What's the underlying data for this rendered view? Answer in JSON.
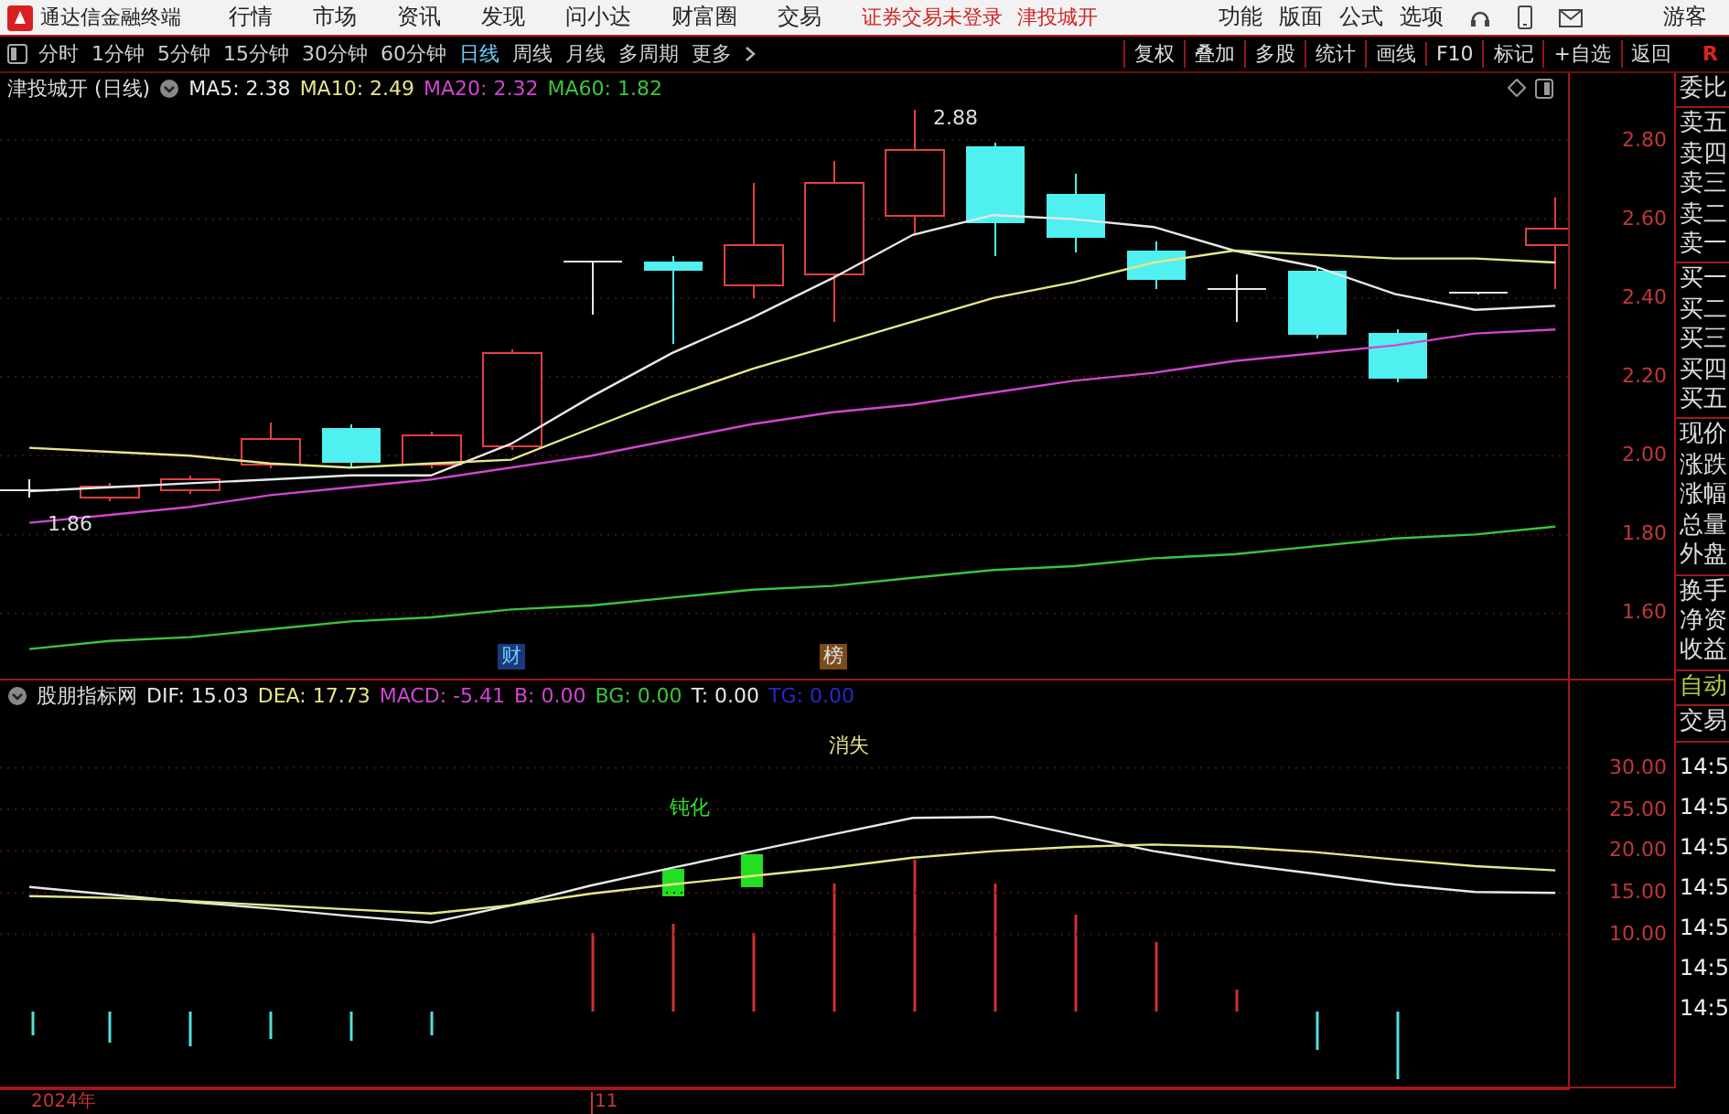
{
  "app_bar": {
    "title": "通达信金融终端",
    "menus": [
      "行情",
      "市场",
      "资讯",
      "发现",
      "问小达",
      "财富圈",
      "交易"
    ],
    "status_messages": [
      "证券交易未登录",
      "津投城开"
    ],
    "tools": [
      "功能",
      "版面",
      "公式",
      "选项"
    ],
    "user": "游客"
  },
  "toolbar": {
    "periods": [
      {
        "label": "分时",
        "selected": false
      },
      {
        "label": "1分钟",
        "selected": false
      },
      {
        "label": "5分钟",
        "selected": false
      },
      {
        "label": "15分钟",
        "selected": false
      },
      {
        "label": "30分钟",
        "selected": false
      },
      {
        "label": "60分钟",
        "selected": false
      },
      {
        "label": "日线",
        "selected": true
      },
      {
        "label": "周线",
        "selected": false
      },
      {
        "label": "月线",
        "selected": false
      },
      {
        "label": "多周期",
        "selected": false
      },
      {
        "label": "更多",
        "selected": false
      }
    ],
    "actions": [
      "复权",
      "叠加",
      "多股",
      "统计",
      "画线",
      "F10",
      "标记",
      "+自选",
      "返回"
    ],
    "badge": "R"
  },
  "chart": {
    "title": "津投城开 (日线)",
    "legend_values": [
      ": 2.38",
      ": 2.49",
      ": 2.32",
      ": 1.82"
    ],
    "high_label": "2.88",
    "low_label": "1.86",
    "markers": [
      {
        "text": "财",
        "color": "#1a3a7a"
      },
      {
        "text": "榜",
        "color": "#7a4a1a"
      }
    ],
    "chart_data": {
      "type": "line",
      "grid": true,
      "ylim": [
        1.43,
        2.97
      ],
      "yticks": [
        {
          "value": 2.8,
          "label": "2.80"
        },
        {
          "value": 2.6,
          "label": "2.60"
        },
        {
          "value": 2.4,
          "label": "2.40"
        },
        {
          "value": 2.2,
          "label": "2.20"
        },
        {
          "value": 2.0,
          "label": "2.00"
        },
        {
          "value": 1.8,
          "label": "1.80"
        },
        {
          "value": 1.6,
          "label": "1.60"
        }
      ],
      "series": [
        {
          "name": "MA5",
          "color": "#e8e8e8",
          "values": [
            1.91,
            1.92,
            1.93,
            1.94,
            1.95,
            1.95,
            2.03,
            2.15,
            2.26,
            2.35,
            2.45,
            2.56,
            2.61,
            2.6,
            2.58,
            2.52,
            2.48,
            2.41,
            2.37,
            2.38
          ]
        },
        {
          "name": "MA10",
          "color": "#e6e68a",
          "values": [
            2.02,
            2.01,
            2.0,
            1.98,
            1.97,
            1.98,
            1.99,
            2.07,
            2.15,
            2.22,
            2.28,
            2.34,
            2.4,
            2.44,
            2.49,
            2.52,
            2.51,
            2.5,
            2.5,
            2.49
          ]
        },
        {
          "name": "MA20",
          "color": "#d046d0",
          "values": [
            1.83,
            1.85,
            1.87,
            1.9,
            1.92,
            1.94,
            1.97,
            2.0,
            2.04,
            2.08,
            2.11,
            2.13,
            2.16,
            2.19,
            2.21,
            2.24,
            2.26,
            2.28,
            2.31,
            2.32
          ]
        },
        {
          "name": "MA60",
          "color": "#3cc43c",
          "values": [
            1.51,
            1.53,
            1.54,
            1.56,
            1.58,
            1.59,
            1.61,
            1.62,
            1.64,
            1.66,
            1.67,
            1.69,
            1.71,
            1.72,
            1.74,
            1.75,
            1.77,
            1.79,
            1.8,
            1.82
          ]
        }
      ]
    }
  },
  "indicator_panel": {
    "name": "股朋指标网",
    "legend_values": [
      ": 15.03",
      ": 17.73"
    ],
    "chart_data": {
      "type": "line",
      "grid": true,
      "ylim": [
        -8.5,
        40.5
      ],
      "yticks": [
        {
          "value": 30,
          "label": "30.00"
        },
        {
          "value": 25,
          "label": "25.00"
        },
        {
          "value": 20,
          "label": "20.00"
        },
        {
          "value": 15,
          "label": "15.00"
        },
        {
          "value": 10,
          "label": "10.00"
        }
      ],
      "series": [
        {
          "name": "DIF",
          "color": "#e8e8e8",
          "values": [
            15.7,
            14.8,
            13.9,
            13.1,
            12.2,
            11.4,
            13.5,
            15.9,
            18.0,
            20.0,
            22.0,
            24.0,
            24.1,
            22.0,
            20.0,
            18.5,
            17.3,
            16.0,
            15.1,
            15.0
          ]
        },
        {
          "name": "DEA",
          "color": "#e6e68a",
          "values": [
            14.6,
            14.4,
            14.0,
            13.5,
            13.0,
            12.5,
            13.5,
            14.9,
            16.0,
            17.0,
            18.0,
            19.2,
            20.0,
            20.5,
            20.8,
            20.5,
            19.9,
            19.0,
            18.2,
            17.7
          ]
        }
      ]
    },
    "legend": [
      {
        "label": "MACD: -5.41",
        "color": "#d046d0"
      },
      {
        "label": "B: 0.00",
        "color": "#d046d0"
      },
      {
        "label": "BG: 0.00",
        "color": "#3cc43c"
      },
      {
        "label": "T: 0.00",
        "color": "#e8e8e8"
      },
      {
        "label": "TG: 0.00",
        "color": "#2828c8"
      }
    ],
    "notes": [
      {
        "text": "消失",
        "color": "#e6e68a"
      },
      {
        "text": "钝化",
        "color": "#30e030"
      }
    ]
  },
  "date_axis": [
    "2024年",
    "11"
  ],
  "quote_panel": {
    "groups": [
      [
        "委比"
      ],
      [
        "卖五",
        "卖四",
        "卖三",
        "卖二",
        "卖一"
      ],
      [
        "买一",
        "买二",
        "买三",
        "买四",
        "买五"
      ],
      [
        "现价",
        "涨跌",
        "涨幅",
        "总量",
        "外盘"
      ],
      [
        "换手",
        "净资",
        "收益"
      ]
    ],
    "mode": "自动",
    "section": "交易",
    "times": [
      "14:5",
      "14:5",
      "14:5",
      "14:5",
      "14:5",
      "14:5",
      "14:5"
    ]
  }
}
